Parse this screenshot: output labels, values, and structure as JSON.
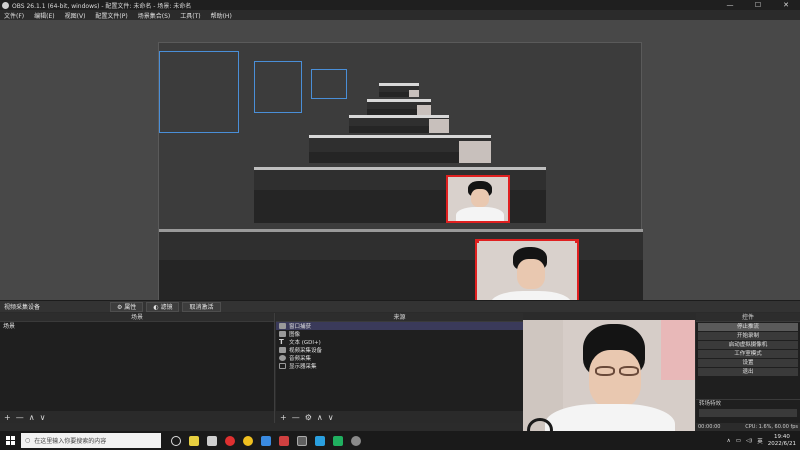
{
  "window": {
    "title": "OBS 26.1.1 (64-bit, windows) - 配置文件: 未命名 - 场景: 未命名",
    "controls": [
      "—",
      "☐",
      "✕"
    ]
  },
  "menu": [
    "文件(F)",
    "编辑(E)",
    "视图(V)",
    "配置文件(P)",
    "场景集合(S)",
    "工具(T)",
    "帮助(H)"
  ],
  "source_bar": {
    "label": "视频采集设备",
    "properties_label": "属性",
    "filters_label": "滤镜",
    "deactivate_label": "取消激活"
  },
  "scenes_panel": {
    "header": "场景",
    "items": [
      "场景"
    ],
    "footer": [
      "+",
      "—",
      "∧",
      "∨"
    ]
  },
  "sources_panel": {
    "header": "来源",
    "items": [
      {
        "label": "窗口捕获",
        "icon": "window-icon",
        "selected": true
      },
      {
        "label": "图像",
        "icon": "image-icon",
        "selected": false
      },
      {
        "label": "文本 (GDI+)",
        "icon": "text-icon",
        "selected": false
      },
      {
        "label": "视频采集设备",
        "icon": "camera-icon",
        "selected": false
      },
      {
        "label": "音频采集",
        "icon": "audio-icon",
        "selected": false
      },
      {
        "label": "显示器采集",
        "icon": "monitor-icon",
        "selected": false
      }
    ],
    "footer": [
      "+",
      "—",
      "⚙",
      "∧",
      "∨"
    ]
  },
  "controls_panel": {
    "header": "控件",
    "buttons": [
      "停止推流",
      "开始录制",
      "启动虚拟摄像机",
      "工作室模式",
      "设置",
      "退出"
    ]
  },
  "transitions_panel": {
    "header": "转场特效"
  },
  "status": {
    "time": "00:00:00",
    "cpu": "CPU: 1.6%, 60.00 fps"
  },
  "taskbar": {
    "search_placeholder": "在这里输入你要搜索的内容",
    "ime": "英",
    "time": "19:40",
    "date": "2022/6/21"
  },
  "colors": {
    "selection": "#e02020",
    "accent_blue": "#4a8fd8",
    "panel_bg": "#1f1f1f"
  }
}
